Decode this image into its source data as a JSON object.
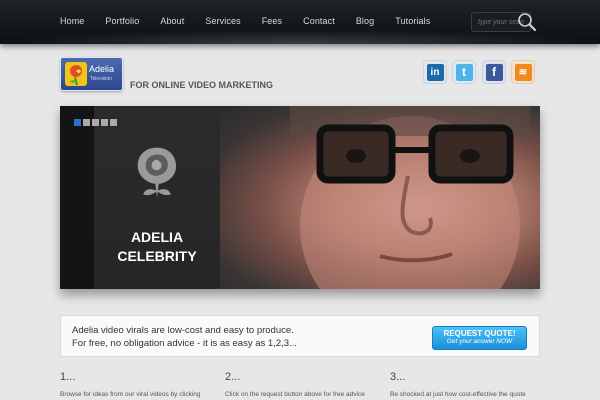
{
  "nav": {
    "items": [
      "Home",
      "Portfolio",
      "About",
      "Services",
      "Fees",
      "Contact",
      "Blog",
      "Tutorials"
    ],
    "search_placeholder": "type your search"
  },
  "header": {
    "logo_name": "Adelia",
    "logo_sub": "Television",
    "tagline": "FOR ONLINE VIDEO MARKETING",
    "social": [
      {
        "name": "linkedin",
        "glyph": "in",
        "color": "#1e6aa8"
      },
      {
        "name": "twitter",
        "glyph": "t",
        "color": "#4fb3e8"
      },
      {
        "name": "facebook",
        "glyph": "f",
        "color": "#3b5998"
      },
      {
        "name": "rss",
        "glyph": "≋",
        "color": "#f08a1c"
      }
    ]
  },
  "hero": {
    "title_line1": "ADELIA",
    "title_line2": "CELEBRITY",
    "slides": 5,
    "active_slide": 1
  },
  "callout": {
    "line1": "Adelia video virals are low-cost and easy to produce.",
    "line2": "For free, no obligation advice - it is as easy as 1,2,3...",
    "button_main": "REQUEST QUOTE!",
    "button_sub": "Get your answer NOW"
  },
  "columns": [
    {
      "num": "1...",
      "text": "Browse for ideas from our viral videos by clicking"
    },
    {
      "num": "2...",
      "text": "Click on the request button above for free advice"
    },
    {
      "num": "3...",
      "text": "Be shocked at just how cost-effective the quote"
    }
  ],
  "colors": {
    "nav_bg": "#0d1012",
    "accent_blue": "#2d6fc4",
    "button_blue": "#1b8fd8"
  }
}
